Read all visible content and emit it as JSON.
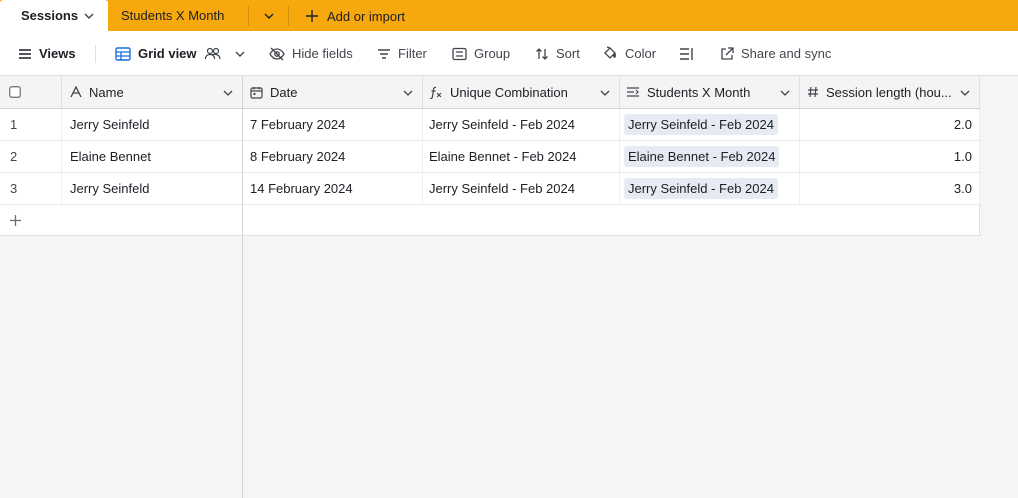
{
  "tabs": {
    "active": "Sessions",
    "second": "Students X Month",
    "add_label": "Add or import"
  },
  "toolbar": {
    "views": "Views",
    "grid_view": "Grid view",
    "hide_fields": "Hide fields",
    "filter": "Filter",
    "group": "Group",
    "sort": "Sort",
    "color": "Color",
    "share": "Share and sync"
  },
  "columns": {
    "name": "Name",
    "date": "Date",
    "unique": "Unique Combination",
    "students": "Students X Month",
    "length": "Session length (hou..."
  },
  "rows": [
    {
      "num": "1",
      "name": "Jerry Seinfeld",
      "date": "7 February 2024",
      "unique": "Jerry Seinfeld - Feb 2024",
      "students": "Jerry Seinfeld - Feb 2024",
      "length": "2.0"
    },
    {
      "num": "2",
      "name": "Elaine Bennet",
      "date": "8 February 2024",
      "unique": "Elaine Bennet - Feb 2024",
      "students": "Elaine Bennet - Feb 2024",
      "length": "1.0"
    },
    {
      "num": "3",
      "name": "Jerry Seinfeld",
      "date": "14 February 2024",
      "unique": "Jerry Seinfeld - Feb 2024",
      "students": "Jerry Seinfeld - Feb 2024",
      "length": "3.0"
    }
  ],
  "colors": {
    "tabbar": "#f7a80d",
    "pill": "#e6ebf3",
    "accent": "#166ee1"
  }
}
